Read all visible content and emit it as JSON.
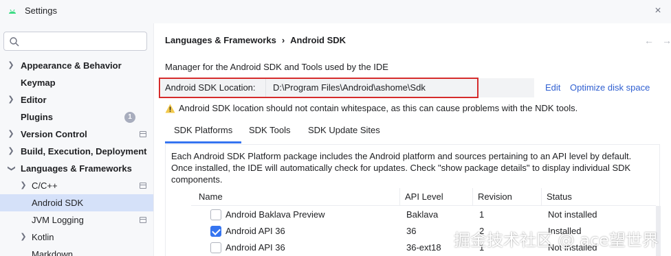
{
  "window": {
    "title": "Settings",
    "close_symbol": "×"
  },
  "sidebar": {
    "search": {
      "placeholder": "",
      "value": ""
    },
    "items": [
      {
        "label": "Appearance & Behavior",
        "expandable": true,
        "expanded": false
      },
      {
        "label": "Keymap"
      },
      {
        "label": "Editor",
        "expandable": true,
        "expanded": false
      },
      {
        "label": "Plugins",
        "badge": "1"
      },
      {
        "label": "Version Control",
        "expandable": true,
        "expanded": false
      },
      {
        "label": "Build, Execution, Deployment",
        "expandable": true,
        "expanded": false
      },
      {
        "label": "Languages & Frameworks",
        "expandable": true,
        "expanded": true
      },
      {
        "label": "C/C++",
        "expandable": true,
        "expanded": false
      },
      {
        "label": "Android SDK",
        "selected": true
      },
      {
        "label": "JVM Logging"
      },
      {
        "label": "Kotlin",
        "expandable": true,
        "expanded": false
      },
      {
        "label": "Markdown"
      }
    ]
  },
  "main": {
    "breadcrumb": {
      "parent": "Languages & Frameworks",
      "separator": "›",
      "current": "Android SDK"
    },
    "nav": {
      "back": "←",
      "forward": "→"
    },
    "description": "Manager for the Android SDK and Tools used by the IDE",
    "sdk_location": {
      "label": "Android SDK Location:",
      "value": "D:\\Program Files\\Android\\ashome\\Sdk"
    },
    "links": {
      "edit": "Edit",
      "optimize": "Optimize disk space"
    },
    "warning": "Android SDK location should not contain whitespace, as this can cause problems with the NDK tools.",
    "tabs": [
      "SDK Platforms",
      "SDK Tools",
      "SDK Update Sites"
    ],
    "active_tab": 0,
    "panel_description": "Each Android SDK Platform package includes the Android platform and sources pertaining to an API level by default. Once installed, the IDE will automatically check for updates. Check \"show package details\" to display individual SDK components.",
    "table": {
      "columns": [
        "Name",
        "API Level",
        "Revision",
        "Status"
      ],
      "rows": [
        {
          "checked": false,
          "name": "Android Baklava Preview",
          "api": "Baklava",
          "revision": "1",
          "status": "Not installed"
        },
        {
          "checked": true,
          "name": "Android API 36",
          "api": "36",
          "revision": "2",
          "status": "Installed"
        },
        {
          "checked": false,
          "name": "Android API 36",
          "api": "36-ext18",
          "revision": "1",
          "status": "Not installed"
        }
      ]
    }
  },
  "watermark": "掘金技术社区 @ ace望世界",
  "colors": {
    "accent": "#3574f0",
    "highlight_border": "#d52b2b",
    "link": "#2f5fd1",
    "warning": "#f2c94c"
  }
}
